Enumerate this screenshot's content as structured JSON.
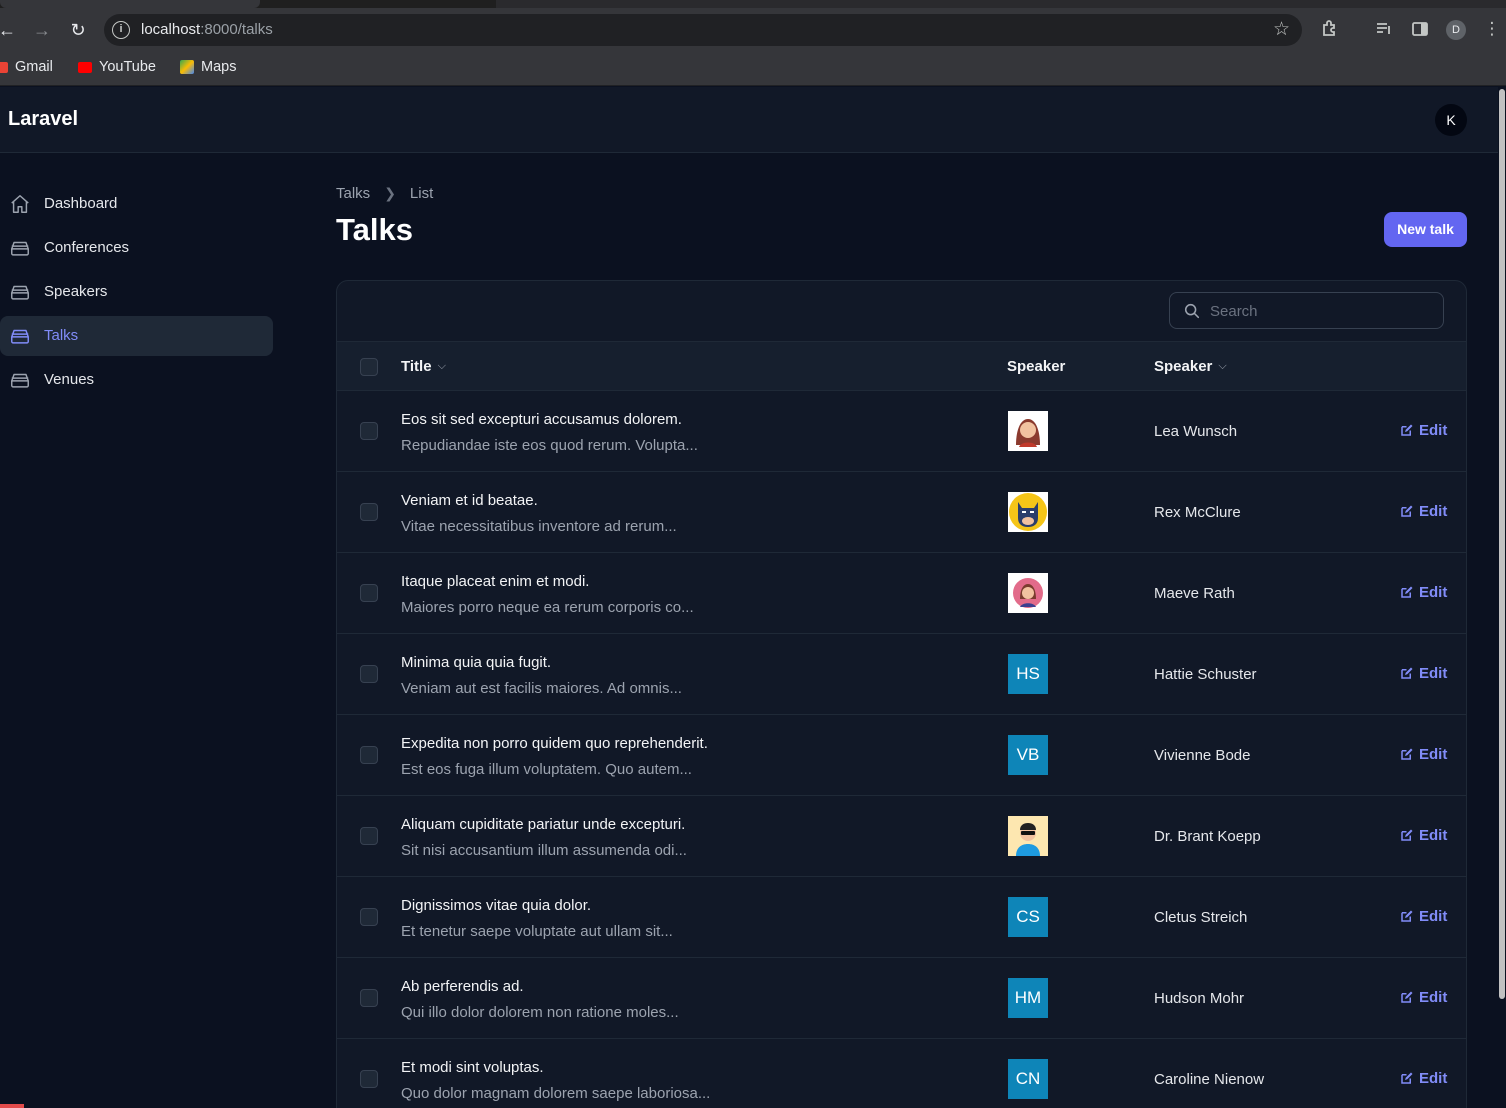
{
  "browser": {
    "url_host": "localhost",
    "url_path": ":8000/talks",
    "bookmarks": [
      {
        "label": "Gmail",
        "color": "#ea4335"
      },
      {
        "label": "YouTube",
        "color": "#ff0000"
      },
      {
        "label": "Maps",
        "color": "#34a853"
      }
    ],
    "profile_initial": "D"
  },
  "app": {
    "brand": "Laravel",
    "user_initial": "K",
    "accent": "#6366f1"
  },
  "sidebar": {
    "items": [
      {
        "label": "Dashboard",
        "icon": "home-icon"
      },
      {
        "label": "Conferences",
        "icon": "inbox-icon"
      },
      {
        "label": "Speakers",
        "icon": "inbox-icon"
      },
      {
        "label": "Talks",
        "icon": "inbox-icon",
        "active": true
      },
      {
        "label": "Venues",
        "icon": "inbox-icon"
      }
    ]
  },
  "header": {
    "breadcrumb": [
      "Talks",
      "List"
    ],
    "title": "Talks",
    "new_button": "New talk"
  },
  "table": {
    "search_placeholder": "Search",
    "columns": {
      "title": "Title",
      "speaker_avatar": "Speaker",
      "speaker_name": "Speaker"
    },
    "edit_label": "Edit",
    "rows": [
      {
        "title": "Eos sit sed excepturi accusamus dolorem.",
        "desc": "Repudiandae iste eos quod rerum. Volupta...",
        "avatar": "woman-red-hair",
        "speaker": "Lea Wunsch"
      },
      {
        "title": "Veniam et id beatae.",
        "desc": "Vitae necessitatibus inventore ad rerum...",
        "avatar": "batman",
        "speaker": "Rex McClure"
      },
      {
        "title": "Itaque placeat enim et modi.",
        "desc": "Maiores porro neque ea rerum corporis co...",
        "avatar": "woman-pink",
        "speaker": "Maeve Rath"
      },
      {
        "title": "Minima quia quia fugit.",
        "desc": "Veniam aut est facilis maiores. Ad omnis...",
        "initials": "HS",
        "speaker": "Hattie Schuster"
      },
      {
        "title": "Expedita non porro quidem quo reprehenderit.",
        "desc": "Est eos fuga illum voluptatem. Quo autem...",
        "initials": "VB",
        "speaker": "Vivienne Bode"
      },
      {
        "title": "Aliquam cupiditate pariatur unde excepturi.",
        "desc": "Sit nisi accusantium illum assumenda odi...",
        "avatar": "man-sunglasses",
        "speaker": "Dr. Brant Koepp"
      },
      {
        "title": "Dignissimos vitae quia dolor.",
        "desc": "Et tenetur saepe voluptate aut ullam sit...",
        "initials": "CS",
        "speaker": "Cletus Streich"
      },
      {
        "title": "Ab perferendis ad.",
        "desc": "Qui illo dolor dolorem non ratione moles...",
        "initials": "HM",
        "speaker": "Hudson Mohr"
      },
      {
        "title": "Et modi sint voluptas.",
        "desc": "Quo dolor magnam dolorem saepe laboriosa...",
        "initials": "CN",
        "speaker": "Caroline Nienow"
      }
    ]
  }
}
